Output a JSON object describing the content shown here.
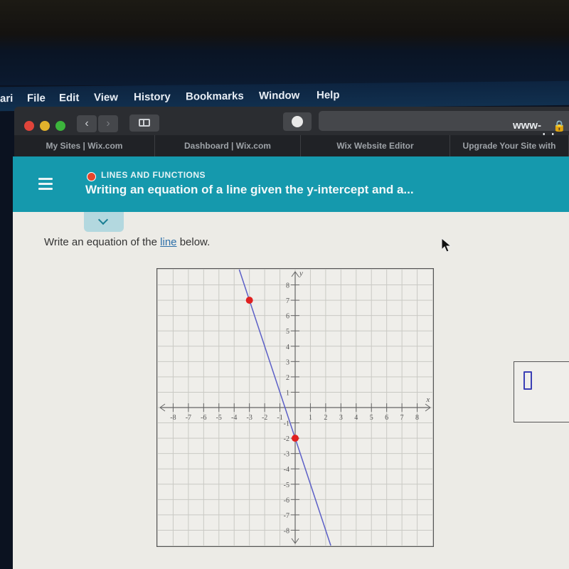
{
  "menubar": {
    "items": [
      "ari",
      "File",
      "Edit",
      "View",
      "History",
      "Bookmarks",
      "Window",
      "Help"
    ]
  },
  "browser": {
    "url": "www-awn.aleks.",
    "tabs": [
      "My Sites | Wix.com",
      "Dashboard | Wix.com",
      "Wix Website Editor",
      "Upgrade Your Site with"
    ]
  },
  "header": {
    "topic": "LINES AND FUNCTIONS",
    "title": "Writing an equation of a line given the y-intercept and a..."
  },
  "question": {
    "prefix": "Write an equation of the ",
    "link": "line",
    "suffix": " below."
  },
  "chart_data": {
    "type": "line",
    "title": "",
    "xlabel": "x",
    "ylabel": "y",
    "xlim": [
      -9,
      9
    ],
    "ylim": [
      -9,
      9
    ],
    "grid": true,
    "x_ticks": [
      -8,
      -7,
      -6,
      -5,
      -4,
      -3,
      -2,
      -1,
      1,
      2,
      3,
      4,
      5,
      6,
      7,
      8
    ],
    "y_ticks": [
      -8,
      -7,
      -6,
      -5,
      -4,
      -3,
      -2,
      -1,
      1,
      2,
      3,
      4,
      5,
      6,
      7,
      8
    ],
    "series": [
      {
        "name": "line",
        "slope": -3,
        "intercept": -2,
        "color": "#5b5fc7"
      }
    ],
    "points": [
      {
        "x": -3,
        "y": 7,
        "color": "#e02020"
      },
      {
        "x": 0,
        "y": -2,
        "color": "#e02020"
      }
    ]
  },
  "answer_box": {
    "value": ""
  }
}
